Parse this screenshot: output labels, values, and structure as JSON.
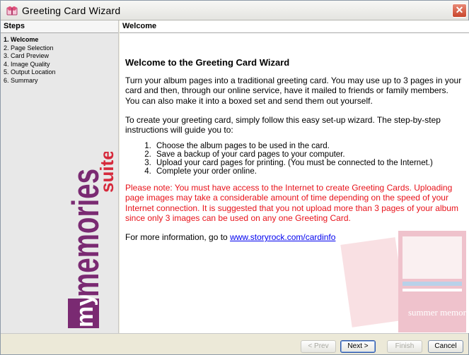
{
  "window": {
    "title": "Greeting Card Wizard"
  },
  "steps": {
    "header": "Steps",
    "items": [
      {
        "label": "1. Welcome",
        "active": true
      },
      {
        "label": "2. Page Selection",
        "active": false
      },
      {
        "label": "3. Card Preview",
        "active": false
      },
      {
        "label": "4. Image Quality",
        "active": false
      },
      {
        "label": "5. Output Location",
        "active": false
      },
      {
        "label": "6. Summary",
        "active": false
      }
    ]
  },
  "logo": {
    "text_my": "my",
    "text_memories": "memories",
    "text_suite": "suite"
  },
  "main": {
    "header": "Welcome",
    "heading": "Welcome to the Greeting Card Wizard",
    "intro": "Turn your album pages into a traditional greeting card. You may use up to 3 pages in your card and then, through our online service, have it mailed to friends or family members. You can also make it into a boxed set and send them out yourself.",
    "instructions": "To create your greeting card, simply follow this easy set-up wizard. The step-by-step instructions will guide you to:",
    "list": [
      "Choose the album pages to be used in the card.",
      "Save a backup of your card pages to your computer.",
      "Upload your card pages for printing. (You must be connected to the Internet.)",
      "Complete your order online."
    ],
    "note": "Please note: You must have access to the Internet to create Greeting Cards. Uploading page images may take a considerable amount of time depending on the speed of your Internet connection. It is suggested that you not upload more than 3 pages of your album since only 3 images can be used on any one Greeting Card.",
    "more_info_prefix": "For more information, go to ",
    "more_info_link": "www.storyrock.com/cardinfo",
    "bg_art_text": "summer memories"
  },
  "footer": {
    "prev_label": "< Prev",
    "next_label": "Next >",
    "finish_label": "Finish",
    "cancel_label": "Cancel"
  },
  "colors": {
    "note_red": "#e8121a",
    "logo_purple": "#7a2a72",
    "logo_red": "#d62a3c",
    "link_blue": "#0000ee"
  },
  "icons": {
    "app": "greeting-card-icon",
    "close": "close-icon"
  }
}
